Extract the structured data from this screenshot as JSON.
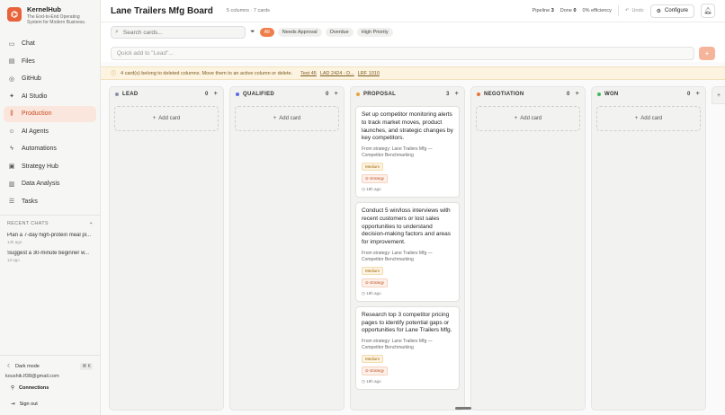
{
  "app": {
    "name": "KernelHub",
    "tagline": "The End-to-End Operating System for Modern Business."
  },
  "sidebar": {
    "items": [
      {
        "label": "Chat",
        "icon": "chat-icon",
        "active": false
      },
      {
        "label": "Files",
        "icon": "folder-icon",
        "active": false
      },
      {
        "label": "GitHub",
        "icon": "github-icon",
        "active": false
      },
      {
        "label": "AI Studio",
        "icon": "sparkle-icon",
        "active": false
      },
      {
        "label": "Production",
        "icon": "kanban-icon",
        "active": true
      },
      {
        "label": "AI Agents",
        "icon": "bot-icon",
        "active": false
      },
      {
        "label": "Automations",
        "icon": "zap-icon",
        "active": false
      },
      {
        "label": "Strategy Hub",
        "icon": "briefcase-icon",
        "active": false
      },
      {
        "label": "Data Analysis",
        "icon": "bar-chart-icon",
        "active": false
      },
      {
        "label": "Tasks",
        "icon": "list-icon",
        "active": false
      }
    ],
    "recent_label": "RECENT CHATS",
    "recent_chats": [
      {
        "title": "Plan a 7-day high-protein meal pl...",
        "time": "14h ago"
      },
      {
        "title": "Suggest a 30-minute beginner w...",
        "time": "1d ago"
      }
    ],
    "dark_mode_label": "Dark mode",
    "dark_mode_shortcut": "⌘ K",
    "user_email": "koushik.lf38@gmail.com",
    "connections_label": "Connections",
    "signout_label": "Sign out"
  },
  "header": {
    "title": "Lane Trailers Mfg Board",
    "meta": "5 columns · 7 cards",
    "pipeline_label": "Pipeline",
    "pipeline_value": "3",
    "done_label": "Done",
    "done_value": "0",
    "efficiency": "0% efficiency",
    "undo_label": "Undo",
    "configure_label": "Configure"
  },
  "filters": {
    "search_placeholder": "Search cards...",
    "chips": [
      {
        "label": "All",
        "active": true
      },
      {
        "label": "Needs Approval",
        "active": false
      },
      {
        "label": "Overdue",
        "active": false
      },
      {
        "label": "High Priority",
        "active": false
      }
    ]
  },
  "quick_add": {
    "placeholder": "Quick add to \"Lead\"...",
    "button": "+"
  },
  "warning": {
    "text": "4 card(s) belong to deleted columns. Move them to an active column or delete.",
    "links": [
      "Test 45",
      "LAD 2424 - D...",
      "LRF 1010"
    ]
  },
  "columns": [
    {
      "name": "LEAD",
      "count": "0",
      "color": "#8a93a6",
      "add_label": "Add card",
      "cards": []
    },
    {
      "name": "QUALIFIED",
      "count": "0",
      "color": "#5b6be0",
      "add_label": "Add card",
      "cards": []
    },
    {
      "name": "PROPOSAL",
      "count": "3",
      "color": "#e8a33a",
      "add_label": "",
      "cards": [
        {
          "title": "Set up competitor monitoring alerts to track market moves, product launches, and strategic changes by key competitors.",
          "source": "From strategy: Lane Trailers Mfg — Competitor Benchmarking",
          "priority": "Medium",
          "tag": "strategy",
          "time": "18h ago"
        },
        {
          "title": "Conduct 5 win/loss interviews with recent customers or lost sales opportunities to understand decision-making factors and areas for improvement.",
          "source": "From strategy: Lane Trailers Mfg — Competitor Benchmarking",
          "priority": "Medium",
          "tag": "strategy",
          "time": "18h ago"
        },
        {
          "title": "Research top 3 competitor pricing pages to identify potential gaps or opportunities for Lane Trailers Mfg.",
          "source": "From strategy: Lane Trailers Mfg — Competitor Benchmarking",
          "priority": "Medium",
          "tag": "strategy",
          "time": "18h ago"
        }
      ]
    },
    {
      "name": "NEGOTIATION",
      "count": "0",
      "color": "#e8743a",
      "add_label": "Add card",
      "cards": []
    },
    {
      "name": "WON",
      "count": "0",
      "color": "#3fb860",
      "add_label": "Add card",
      "cards": []
    }
  ]
}
